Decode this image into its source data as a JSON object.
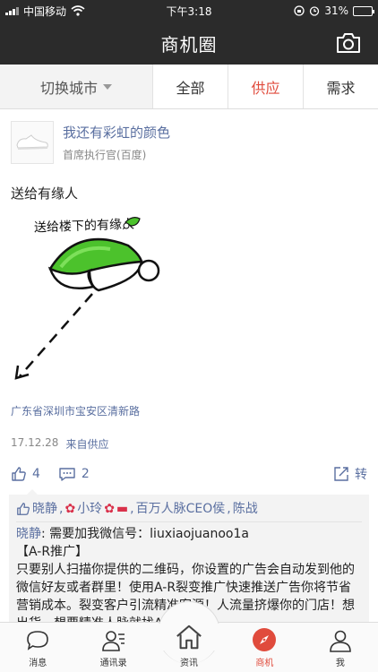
{
  "status": {
    "carrier": "中国移动",
    "time": "下午3:18",
    "battery": "31%",
    "battery_level": 0.31
  },
  "header": {
    "title": "商机圈",
    "camera_icon": "camera-icon"
  },
  "filters": {
    "city": "切换城市",
    "tabs": [
      "全部",
      "供应",
      "需求"
    ],
    "active": "供应",
    "accent": "#e04b3c"
  },
  "post": {
    "author": "我还有彩虹的颜色",
    "subtitle": "首席执行官(百度)",
    "text": "送给有缘人",
    "image_caption": "送给楼下的有缘人",
    "location": "广东省深圳市宝安区清新路",
    "date": "17.12.28",
    "source": "来自供应",
    "likes": "4",
    "comments_count": "2",
    "forward": "转",
    "liked_by": [
      "晓静",
      "小玲",
      "百万人脉CEO侯",
      "陈战"
    ],
    "comment": {
      "author": "晓静",
      "text": "需要加我微信号：liuxiaojuanoo1a",
      "body": "【A-R推广】\n只要别人扫描你提供的二维码，你设置的广告会自动发到他的微信好友或者群里！使用A-R裂变推广快速推送广告你将节省营销成本。裂变客户引流精准客源！人流量挤爆你的门店！想出货，想要精准人脉就找A-R推广！"
    }
  },
  "tabbar": {
    "items": [
      "消息",
      "通讯录",
      "资讯",
      "商机",
      "我"
    ],
    "active": "商机"
  }
}
